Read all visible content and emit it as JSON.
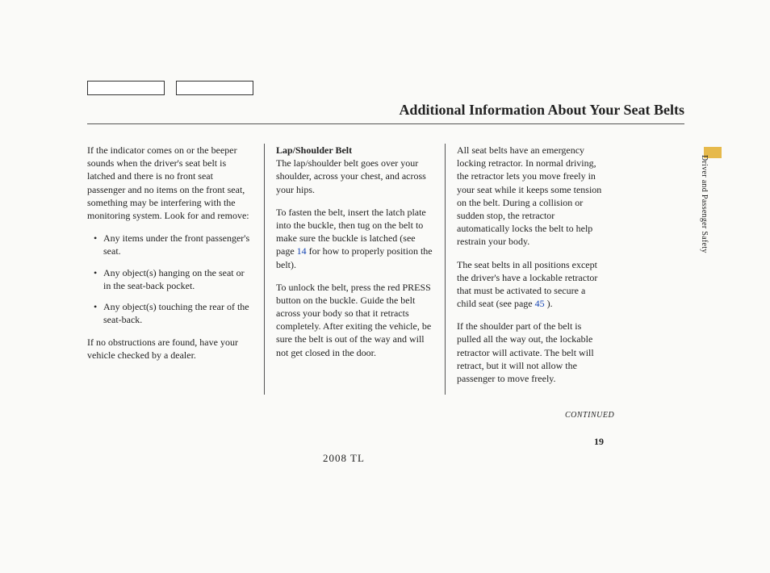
{
  "title": "Additional Information About Your Seat Belts",
  "col1": {
    "p1": "If the indicator comes on or the beeper sounds when the driver's seat belt is latched and there is no front seat passenger and no items on the front seat, something may be interfering with the monitoring system. Look for and remove:",
    "bullets": [
      "Any items under the front passenger's seat.",
      "Any object(s) hanging on the seat or in the seat-back pocket.",
      "Any object(s) touching the rear of the seat-back."
    ],
    "p2": "If no obstructions are found, have your vehicle checked by a dealer."
  },
  "col2": {
    "subhead": "Lap/Shoulder Belt",
    "p1": "The lap/shoulder belt goes over your shoulder, across your chest, and across your hips.",
    "p2a": "To fasten the belt, insert the latch plate into the buckle, then tug on the belt to make sure the buckle is latched (see page ",
    "p2link": "14",
    "p2b": " for how to properly position the belt).",
    "p3": "To unlock the belt, press the red PRESS button on the buckle. Guide the belt across your body so that it retracts completely. After exiting the vehicle, be sure the belt is out of the way and will not get closed in the door."
  },
  "col3": {
    "p1": "All seat belts have an emergency locking retractor. In normal driving, the retractor lets you move freely in your seat while it keeps some tension on the belt. During a collision or sudden stop, the retractor automatically locks the belt to help restrain your body.",
    "p2a": "The seat belts in all positions except the driver's have a lockable retractor that must be activated to secure a child seat (see page ",
    "p2link": "45",
    "p2b": " ).",
    "p3": "If the shoulder part of the belt is pulled all the way out, the lockable retractor will activate. The belt will retract, but it will not allow the passenger to move freely."
  },
  "sideLabel": "Driver and Passenger Safety",
  "continued": "CONTINUED",
  "pageNum": "19",
  "footerModel": "2008  TL"
}
